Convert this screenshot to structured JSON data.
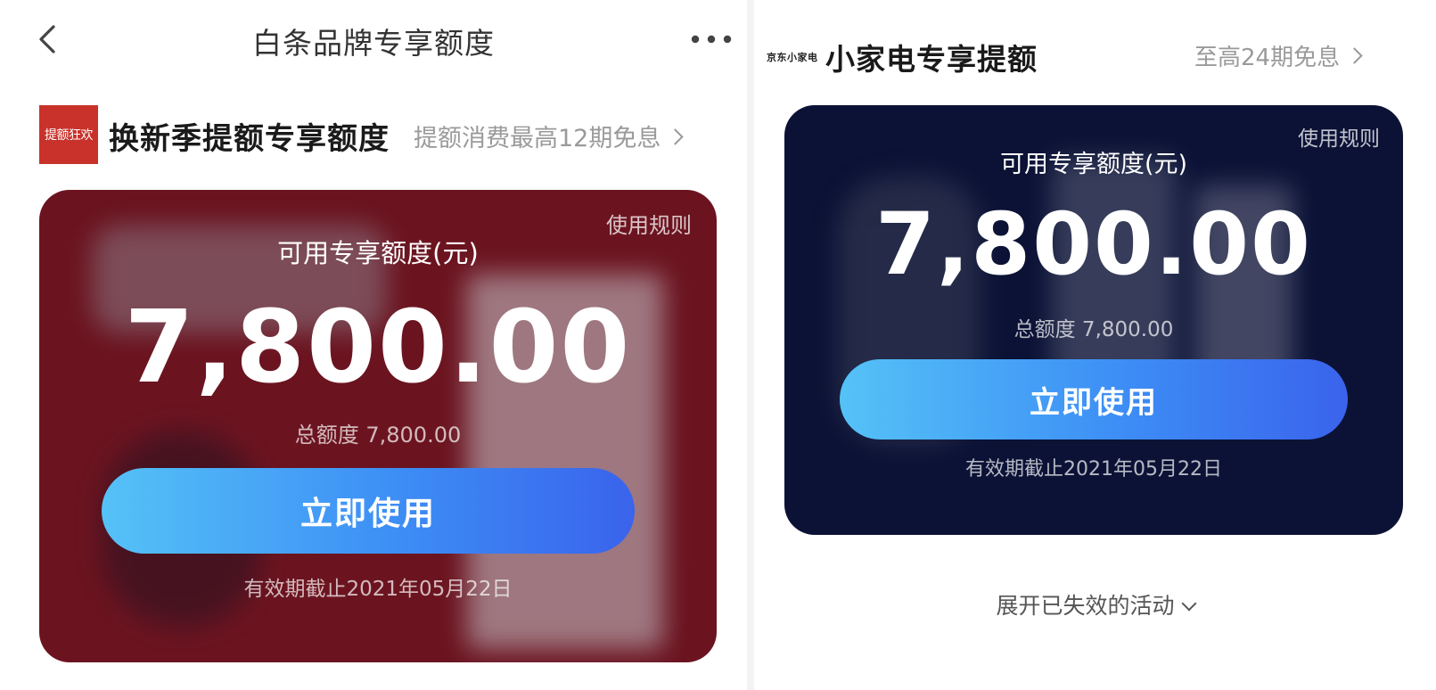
{
  "nav": {
    "title": "白条品牌专享额度"
  },
  "left_section": {
    "logo_text": "提额狂欢",
    "title": "换新季提额专享额度",
    "link": "提额消费最高12期免息",
    "card": {
      "rules": "使用规则",
      "label": "可用专享额度(元)",
      "amount": "7,800.00",
      "total": "总额度 7,800.00",
      "button": "立即使用",
      "expiry": "有效期截止2021年05月22日",
      "bg_color": "#6b1420"
    }
  },
  "right_section": {
    "logo_text": "京东小家电",
    "title": "小家电专享提额",
    "link": "至高24期免息",
    "card": {
      "rules": "使用规则",
      "label": "可用专享额度(元)",
      "amount": "7,800.00",
      "total": "总额度 7,800.00",
      "button": "立即使用",
      "expiry": "有效期截止2021年05月22日",
      "bg_color": "#0b1236"
    },
    "expand": "展开已失效的活动"
  },
  "icons": {
    "back": "chevron-left-icon",
    "more": "more-dots-icon",
    "link_arrow": "chevron-right-icon",
    "expand_arrow": "chevron-down-icon"
  },
  "colors": {
    "button_gradient_start": "#55c2f7",
    "button_gradient_end": "#3a63ec",
    "logo_red": "#c8322a"
  }
}
